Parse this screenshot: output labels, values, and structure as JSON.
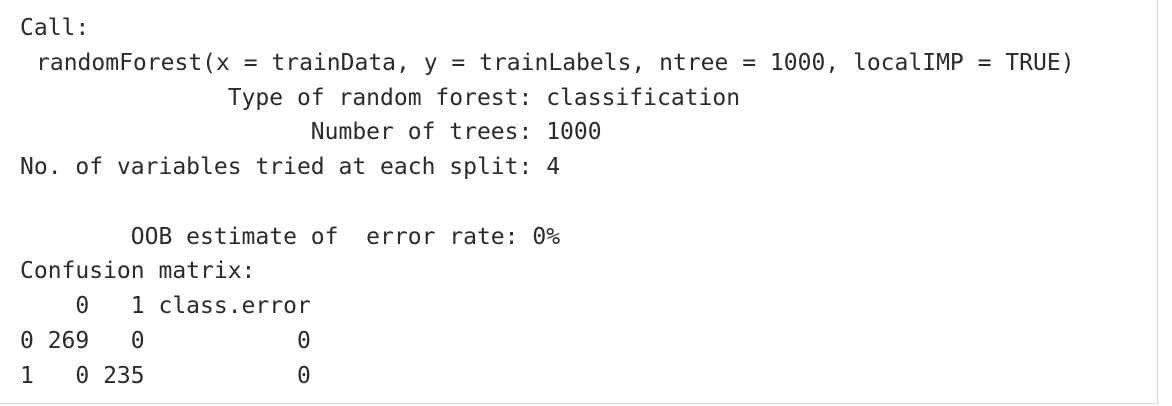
{
  "console_output": {
    "call_label": "Call:",
    "call_expression": "randomForest(x = trainData, y = trainLabels, ntree = 1000, localIMP = TRUE)",
    "forest_type": "               Type of random forest: classification",
    "number_of_trees": "                     Number of trees: 1000",
    "variables_tried": "No. of variables tried at each split: 4",
    "oob_estimate": "        OOB estimate of  error rate: 0%",
    "confusion_label": "Confusion matrix:",
    "matrix_header": "    0   1 class.error",
    "matrix_rows": [
      "0 269   0           0",
      "1   0 235           0"
    ]
  }
}
